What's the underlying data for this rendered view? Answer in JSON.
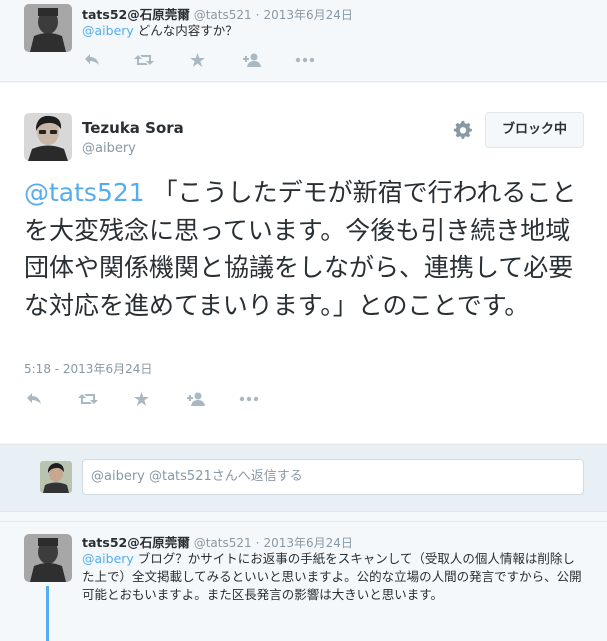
{
  "top_tweet": {
    "name": "tats52@石原莞爾",
    "handle": "@tats521",
    "dot": "·",
    "date": "2013年6月24日",
    "mention": "@aibery",
    "text": "どんな内容すか？"
  },
  "main_tweet": {
    "name": "Tezuka Sora",
    "handle": "@aibery",
    "block_label": "ブロック中",
    "mention": "@tats521",
    "text": "「こうしたデモが新宿で行われることを大変残念に思っています。今後も引き続き地域団体や関係機関と協議をしながら、連携して必要な対応を進めてまいります。」とのことです。",
    "timestamp": "5:18 - 2013年6月24日"
  },
  "reply_box": {
    "placeholder": "@aibery @tats521さんへ返信する"
  },
  "bottom_tweet": {
    "name": "tats52@石原莞爾",
    "handle": "@tats521",
    "dot": "·",
    "date": "2013年6月24日",
    "mention": "@aibery",
    "text": "ブログ？かサイトにお返事の手紙をスキャンして（受取人の個人情報は削除した上で）全文掲載してみるといいと思いますよ。公的な立場の人間の発言ですから、公開可能とおもいますよ。また区長発言の影響は大きいと思います。"
  },
  "icons": [
    "reply-icon",
    "retweet-icon",
    "favorite-icon",
    "follow-icon",
    "more-icon",
    "gear-icon"
  ],
  "colors": {
    "link": "#55acee",
    "icon": "#aab8c2",
    "muted": "#8899a6",
    "text": "#292f33"
  }
}
